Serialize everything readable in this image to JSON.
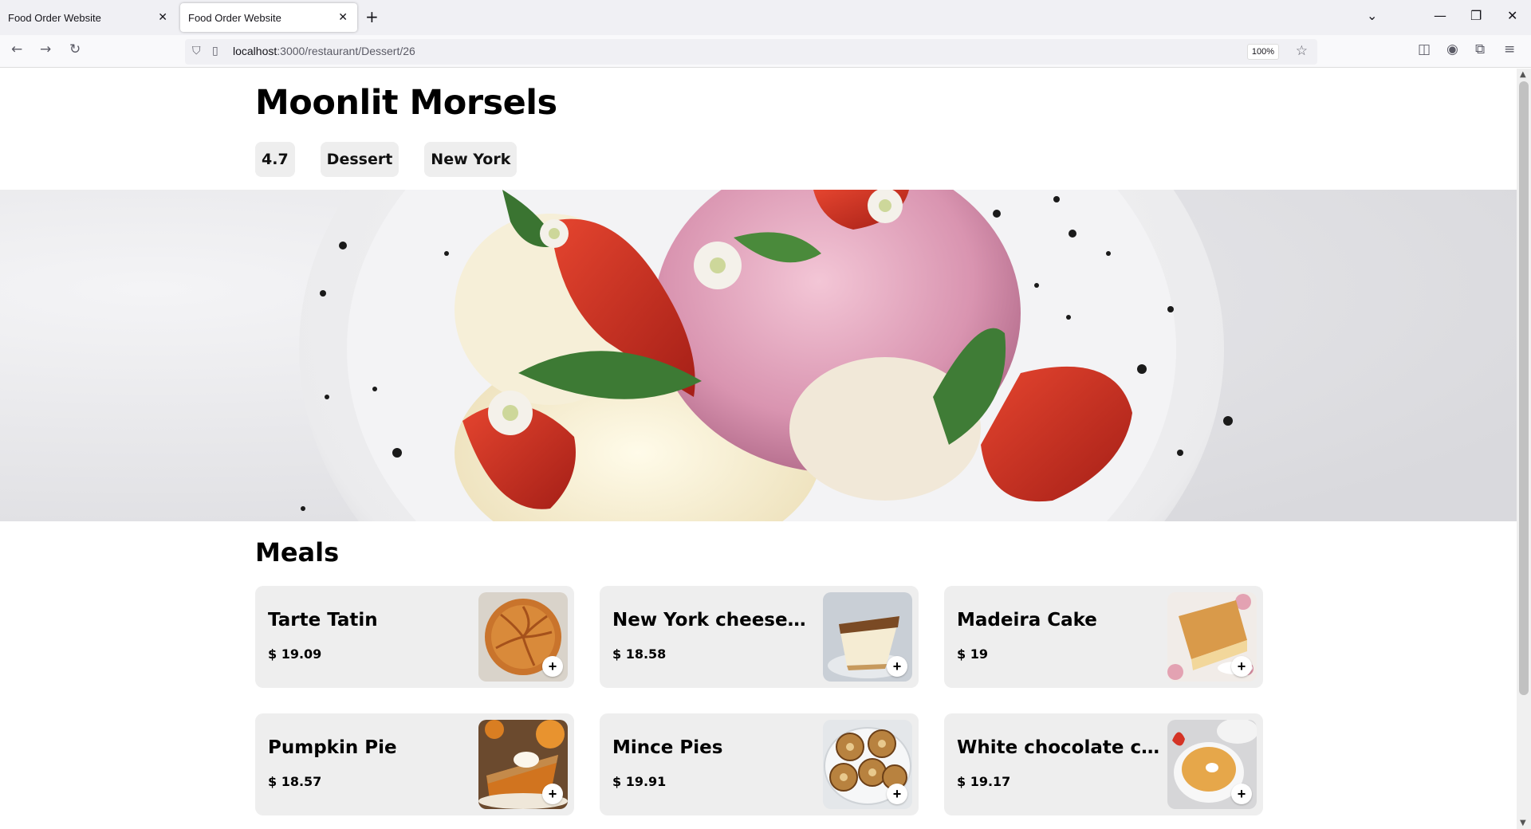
{
  "browser": {
    "tabs": [
      {
        "title": "Food Order Website",
        "active": false
      },
      {
        "title": "Food Order Website",
        "active": true
      }
    ],
    "url_host": "localhost",
    "url_path": ":3000/restaurant/Dessert/26",
    "zoom": "100%"
  },
  "restaurant": {
    "name": "Moonlit Morsels",
    "rating": "4.7",
    "category": "Dessert",
    "city": "New York"
  },
  "meals_title": "Meals",
  "meals": [
    {
      "name": "Tarte Tatin",
      "price": "$ 19.09",
      "add": "+"
    },
    {
      "name": "New York cheeseca...",
      "price": "$ 18.58",
      "add": "+"
    },
    {
      "name": "Madeira Cake",
      "price": "$ 19",
      "add": "+"
    },
    {
      "name": "Pumpkin Pie",
      "price": "$ 18.57",
      "add": "+"
    },
    {
      "name": "Mince Pies",
      "price": "$ 19.91",
      "add": "+"
    },
    {
      "name": "White chocolate cr...",
      "price": "$ 19.17",
      "add": "+"
    }
  ]
}
